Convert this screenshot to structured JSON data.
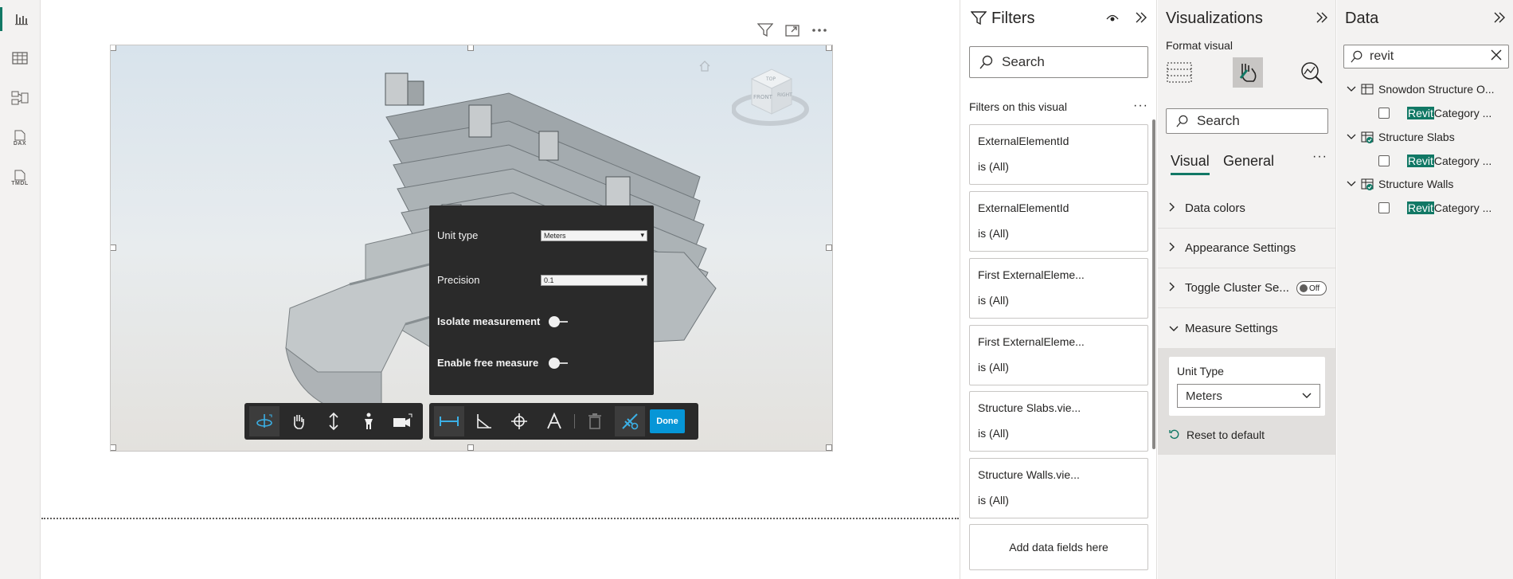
{
  "colors": {
    "accent": "#117865",
    "autodesk_blue": "#0696d7",
    "panel_dark": "#2a2a2a"
  },
  "rail": {
    "icons": [
      "report-view-icon",
      "table-view-icon",
      "model-view-icon",
      "dax-query-icon",
      "tmdl-view-icon"
    ],
    "dax_label": "DAX",
    "tmdl_label": "TMDL"
  },
  "measure_panel": {
    "unit_type_label": "Unit type",
    "unit_type_value": "Meters",
    "precision_label": "Precision",
    "precision_value": "0.1",
    "isolate_label": "Isolate measurement",
    "free_measure_label": "Enable free measure"
  },
  "viewer": {
    "navcube": {
      "top": "TOP",
      "front": "FRONT",
      "right": "RIGHT"
    }
  },
  "toolbar": {
    "done_label": "Done"
  },
  "filters": {
    "title": "Filters",
    "search_placeholder": "Search",
    "section_label": "Filters on this visual",
    "cards": [
      {
        "field": "ExternalElementId",
        "state": "is (All)"
      },
      {
        "field": "ExternalElementId",
        "state": "is (All)"
      },
      {
        "field": "First ExternalEleme...",
        "state": "is (All)"
      },
      {
        "field": "First ExternalEleme...",
        "state": "is (All)"
      },
      {
        "field": "Structure Slabs.vie...",
        "state": "is (All)"
      },
      {
        "field": "Structure Walls.vie...",
        "state": "is (All)"
      }
    ],
    "add_fields_label": "Add data fields here"
  },
  "visualizations": {
    "title": "Visualizations",
    "subtitle": "Format visual",
    "search_placeholder": "Search",
    "tabs": {
      "visual": "Visual",
      "general": "General"
    },
    "sections": {
      "data_colors": "Data colors",
      "appearance": "Appearance Settings",
      "toggle_cluster": "Toggle Cluster Se...",
      "toggle_state": "Off",
      "measure": "Measure Settings"
    },
    "unit_type_label": "Unit Type",
    "unit_type_value": "Meters",
    "reset_label": "Reset to default"
  },
  "data_pane": {
    "title": "Data",
    "search_value": "revit",
    "tables": [
      {
        "name": "Snowdon Structure O...",
        "field_highlight": "Revit",
        "field_rest": " Category ..."
      },
      {
        "name": "Structure Slabs",
        "field_highlight": "Revit",
        "field_rest": " Category ..."
      },
      {
        "name": "Structure Walls",
        "field_highlight": "Revit",
        "field_rest": " Category ..."
      }
    ]
  }
}
